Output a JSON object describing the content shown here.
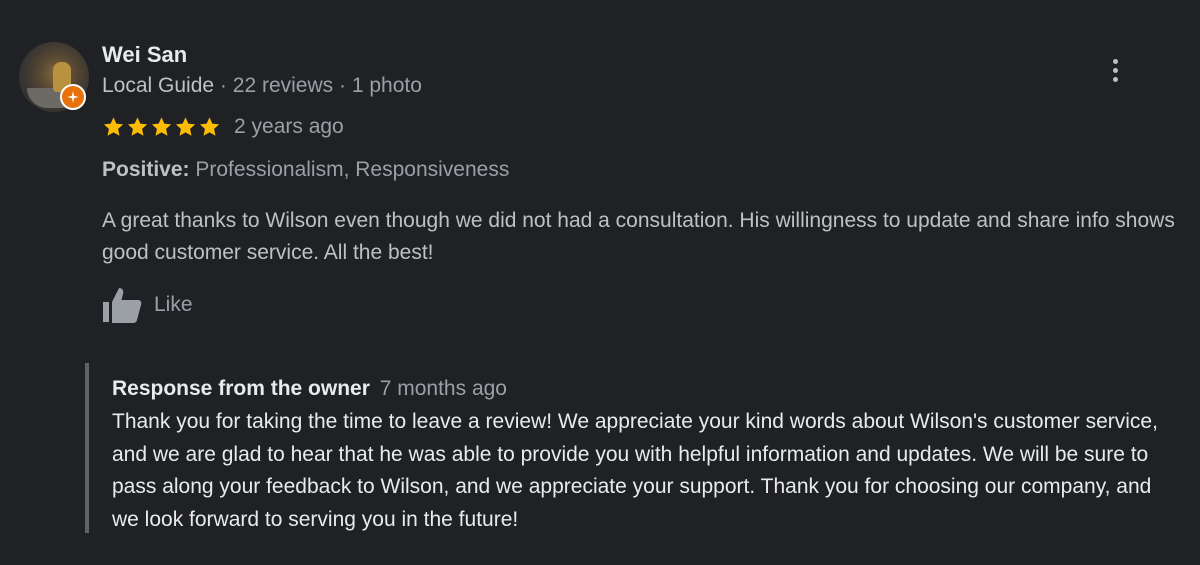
{
  "reviewer": {
    "name": "Wei San",
    "badge": "Local Guide",
    "separator": "·",
    "reviews": "22 reviews",
    "photos": "1 photo"
  },
  "rating": {
    "stars": 5,
    "max": 5,
    "star_color": "#fbbc04",
    "date": "2 years ago"
  },
  "attributes": {
    "label": "Positive:",
    "values": "Professionalism, Responsiveness"
  },
  "review": {
    "text": "A great thanks to Wilson even though we did not had a consultation. His willingness to update and share info shows good customer service. All the best!"
  },
  "actions": {
    "like_label": "Like",
    "like_icon": "thumbs-up-icon",
    "more_icon": "more-vert-icon"
  },
  "owner_response": {
    "title": "Response from the owner",
    "date": "7 months ago",
    "text": "Thank you for taking the time to leave a review! We appreciate your kind words about Wilson's customer service, and we are glad to hear that he was able to provide you with helpful information and updates. We will be sure to pass along your feedback to Wilson, and we appreciate your support. Thank you for choosing our company, and we look forward to serving you in the future!"
  },
  "colors": {
    "background": "#202124",
    "guide_badge": "#e8710a"
  }
}
